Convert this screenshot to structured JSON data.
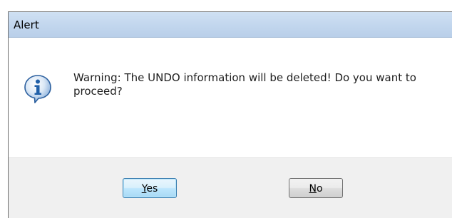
{
  "dialog": {
    "title": "Alert",
    "message": "Warning: The UNDO information will be deleted! Do you want to proceed?",
    "icon": "info-icon",
    "buttons": {
      "yes": {
        "mnemonic": "Y",
        "rest": "es"
      },
      "no": {
        "mnemonic": "N",
        "rest": "o"
      }
    }
  },
  "colors": {
    "titlebar": "#c3d7ee",
    "content_bg": "#ffffff",
    "footer_bg": "#f0f0f0",
    "icon_blue": "#1f5fa8"
  }
}
